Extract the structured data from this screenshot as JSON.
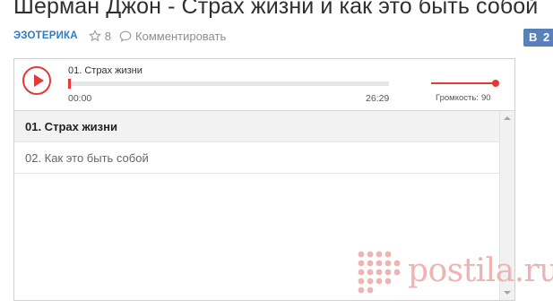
{
  "page": {
    "title": "Шерман Джон - Страх жизни и как это быть собой",
    "category": "ЭЗОТЕРИКА",
    "likes_count": "8",
    "comment_label": "Комментировать",
    "share": {
      "network_letter": "В",
      "count": "2"
    }
  },
  "player": {
    "now_playing": "01. Страх жизни",
    "current_time": "00:00",
    "duration": "26:29",
    "progress_fraction": 0,
    "volume_label": "Громкость:",
    "volume_value": "90",
    "volume_fraction": 1.0
  },
  "playlist": [
    {
      "title": "01. Страх жизни",
      "active": true
    },
    {
      "title": "02. Как это быть собой",
      "active": false
    }
  ],
  "watermark": {
    "text": "postila.ru"
  },
  "colors": {
    "accent": "#e53935",
    "link": "#2e7ac4",
    "vk": "#5981b9"
  },
  "icons": [
    "star-icon",
    "comment-icon",
    "vk-icon",
    "play-icon",
    "scroll-up-icon",
    "scroll-down-icon",
    "postila-logo-icon"
  ]
}
